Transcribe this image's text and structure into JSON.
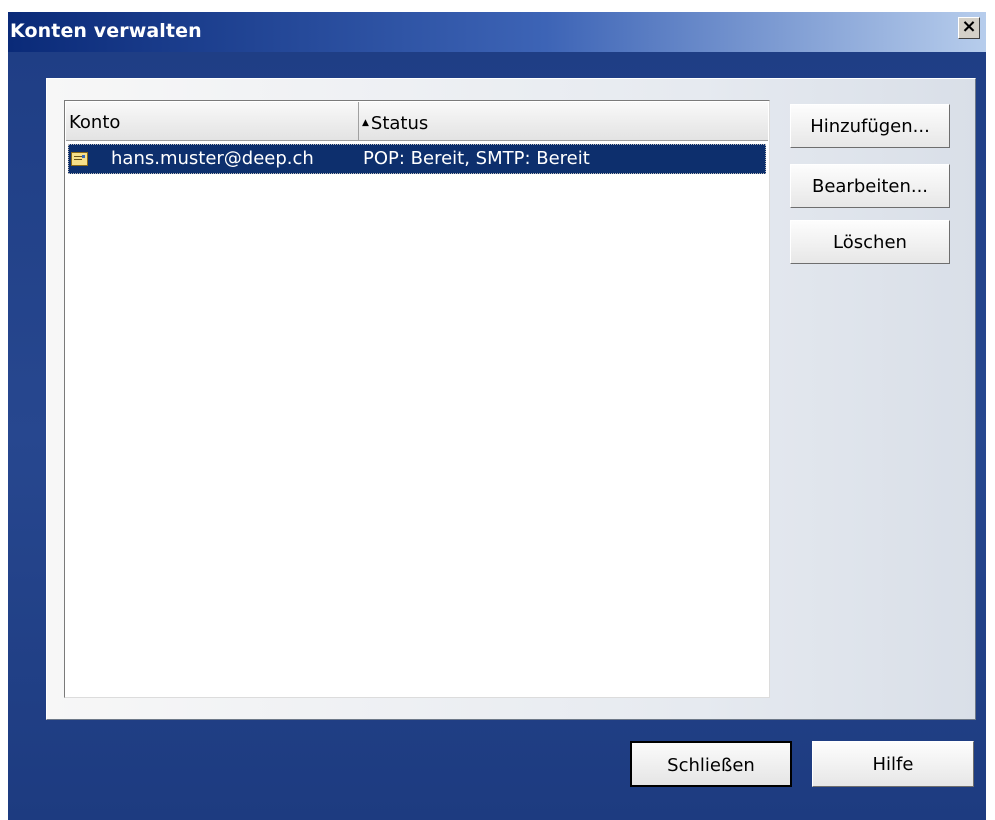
{
  "window": {
    "title": "Konten verwalten",
    "close_glyph": "×"
  },
  "list": {
    "columns": [
      {
        "label": "Konto"
      },
      {
        "label": "Status",
        "sort_indicator": "▲"
      }
    ],
    "rows": [
      {
        "icon": "mail-account-icon",
        "account": "hans.muster@deep.ch",
        "status": "POP: Bereit, SMTP: Bereit",
        "selected": true
      }
    ]
  },
  "side_buttons": {
    "add": "Hinzufügen...",
    "edit": "Bearbeiten...",
    "delete": "Löschen"
  },
  "bottom_buttons": {
    "close": "Schließen",
    "help": "Hilfe"
  },
  "colors": {
    "titlebar_start": "#0a2a78",
    "titlebar_end": "#b7cdec",
    "client_background": "#27478f",
    "selection": "#0d2f6d"
  }
}
